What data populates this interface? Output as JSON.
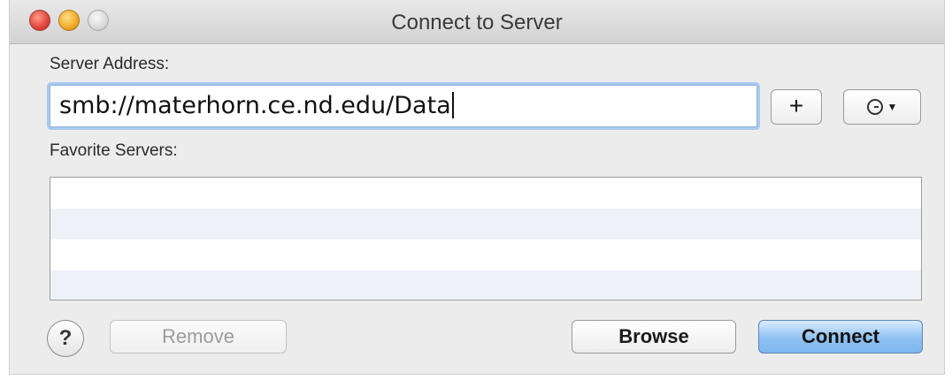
{
  "window": {
    "title": "Connect to Server"
  },
  "server_address": {
    "label": "Server Address:",
    "value": "smb://materhorn.ce.nd.edu/Data"
  },
  "buttons": {
    "add": "+",
    "help": "?",
    "remove": "Remove",
    "browse": "Browse",
    "connect": "Connect"
  },
  "favorites": {
    "label": "Favorite Servers:",
    "items": []
  },
  "icons": {
    "close": "close-circle-icon",
    "minimize": "minimize-circle-icon",
    "zoom": "zoom-circle-icon",
    "history": "clock-icon",
    "dropdown": "chevron-down-icon"
  },
  "colors": {
    "connect_accent": "#8fc1f2",
    "focus_ring": "#a9c9ee",
    "close_red": "#e0443a",
    "minimize_yellow": "#f0a825"
  }
}
